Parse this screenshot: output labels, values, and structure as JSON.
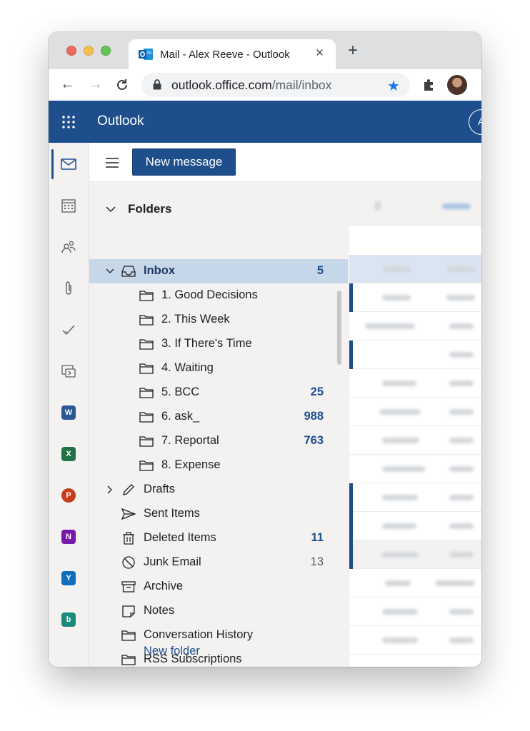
{
  "browser": {
    "tab_title": "Mail - Alex Reeve - Outlook",
    "close_glyph": "×",
    "new_tab_glyph": "+",
    "url_host": "outlook.office.com",
    "url_path": "/mail/inbox",
    "back_glyph": "←",
    "forward_glyph": "→",
    "reload_glyph": "C",
    "star_glyph": "★",
    "star_color": "#1a73e8"
  },
  "header": {
    "app_name": "Outlook",
    "avatar_initial": "A",
    "brand_color": "#1f4e8c"
  },
  "rail": {
    "items": [
      "mail-icon",
      "calendar-icon",
      "people-icon",
      "attachment-icon",
      "todo-icon",
      "groups-icon"
    ],
    "apps": [
      {
        "name": "word-icon",
        "letter": "W",
        "color": "#2b5797"
      },
      {
        "name": "excel-icon",
        "letter": "X",
        "color": "#217346"
      },
      {
        "name": "powerpoint-icon",
        "letter": "P",
        "color": "#c43e1c"
      },
      {
        "name": "onenote-icon",
        "letter": "N",
        "color": "#7719aa"
      },
      {
        "name": "yammer-icon",
        "letter": "Y",
        "color": "#106ebe"
      },
      {
        "name": "bookings-icon",
        "letter": "b",
        "color": "#1a8a7a"
      }
    ]
  },
  "commands": {
    "new_message": "New message"
  },
  "folders": {
    "header": "Folders",
    "inbox": {
      "name": "Inbox",
      "count": "5"
    },
    "subfolders": [
      {
        "name": "1. Good Decisions",
        "count": ""
      },
      {
        "name": "2. This Week",
        "count": ""
      },
      {
        "name": "3. If There's Time",
        "count": ""
      },
      {
        "name": "4. Waiting",
        "count": ""
      },
      {
        "name": "5. BCC",
        "count": "25"
      },
      {
        "name": "6. ask_",
        "count": "988"
      },
      {
        "name": "7. Reportal",
        "count": "763"
      },
      {
        "name": "8. Expense",
        "count": ""
      }
    ],
    "others": [
      {
        "name": "Drafts",
        "count": ""
      },
      {
        "name": "Sent Items",
        "count": ""
      },
      {
        "name": "Deleted Items",
        "count": "11"
      },
      {
        "name": "Junk Email",
        "count": "13"
      },
      {
        "name": "Archive",
        "count": ""
      },
      {
        "name": "Notes",
        "count": ""
      },
      {
        "name": "Conversation History",
        "count": ""
      },
      {
        "name": "RSS Subscriptions",
        "count": ""
      }
    ],
    "new_folder": "New folder"
  }
}
